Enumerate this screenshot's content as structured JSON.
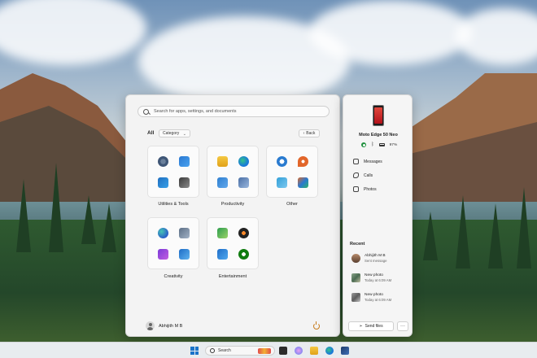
{
  "search": {
    "placeholder": "Search for apps, settings, and documents"
  },
  "nav": {
    "all_label": "All",
    "category_label": "Category",
    "back_label": "Back"
  },
  "folders": [
    {
      "label": "Utilities & Tools"
    },
    {
      "label": "Productivity"
    },
    {
      "label": "Other"
    },
    {
      "label": "Creativity"
    },
    {
      "label": "Entertainment"
    }
  ],
  "user": {
    "name": "Abhijith M B"
  },
  "phone": {
    "device_name": "Moto Edge 50 Neo",
    "battery": "97%",
    "links": [
      "Messages",
      "Calls",
      "Photos"
    ],
    "recent_title": "Recent",
    "recent": [
      {
        "title": "Abhijith M B",
        "subtitle": "Sent message"
      },
      {
        "title": "New photo",
        "subtitle": "Today at 6:09 AM"
      },
      {
        "title": "New photo",
        "subtitle": "Today at 6:09 AM"
      }
    ],
    "send_files": "Send files",
    "more": "···"
  },
  "taskbar": {
    "search_label": "Search"
  },
  "colors": {
    "accent": "#1a73c9",
    "power": "#c77a1a",
    "connected": "#1e8f3c"
  }
}
